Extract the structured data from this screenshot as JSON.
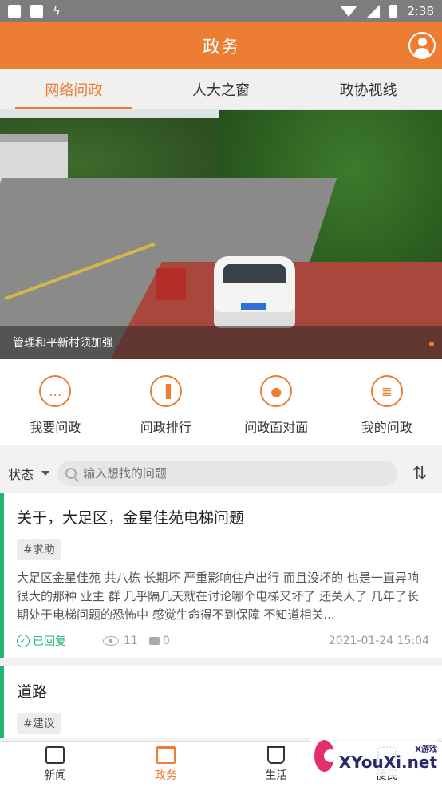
{
  "status_bar": {
    "time": "2:38",
    "left_glyph": "ϟ"
  },
  "header": {
    "title": "政务"
  },
  "tabs": [
    {
      "label": "网络问政",
      "active": true
    },
    {
      "label": "人大之窗",
      "active": false
    },
    {
      "label": "政协视线",
      "active": false
    }
  ],
  "banner": {
    "caption": "管理和平新村须加强",
    "active_dot_color": "#ec7d32"
  },
  "quick_actions": [
    {
      "label": "我要问政",
      "icon": "chat-icon",
      "glyph": "…"
    },
    {
      "label": "问政排行",
      "icon": "bar-chart-icon",
      "glyph": "▐"
    },
    {
      "label": "问政面对面",
      "icon": "people-icon",
      "glyph": "●"
    },
    {
      "label": "我的问政",
      "icon": "notebook-icon",
      "glyph": "≣"
    }
  ],
  "filter": {
    "state_label": "状态",
    "search_placeholder": "输入想找的问题",
    "sort_glyph": "⇅"
  },
  "posts": [
    {
      "title": "关于，大足区，金星佳苑电梯问题",
      "tag": "#求助",
      "body": "大足区金星佳苑 共八栋 长期坏 严重影响住户出行 而且没坏的 也是一直异响 很大的那种  业主 群 几乎隔几天就在讨论哪个电梯又坏了 还关人了  几年了长期处于电梯问题的恐怖中 感觉生命得不到保障  不知道相关...",
      "status": "已回复",
      "views": "11",
      "comments": "0",
      "date": "2021-01-24 15:04"
    },
    {
      "title": "道路",
      "tag": "#建议"
    }
  ],
  "bottom_nav": [
    {
      "label": "新闻",
      "active": false
    },
    {
      "label": "政务",
      "active": true
    },
    {
      "label": "生活",
      "active": false
    },
    {
      "label": "便民",
      "active": false
    }
  ],
  "watermark": {
    "brand": "XYouXi.net",
    "sub": "X游戏"
  },
  "colors": {
    "accent": "#ec7d32",
    "replied": "#22b573",
    "status_bar": "#7d7d7d"
  }
}
